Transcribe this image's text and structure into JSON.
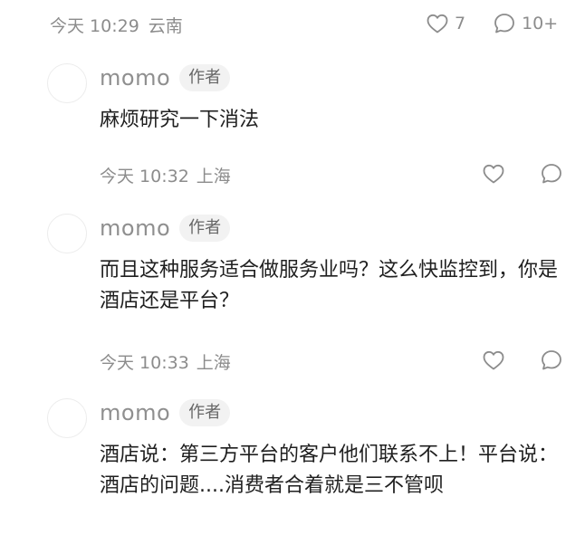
{
  "post": {
    "time": "今天 10:29",
    "location": "云南",
    "like_count": "7",
    "comment_count": "10+"
  },
  "replies": [
    {
      "name": "momo",
      "badge": "作者",
      "text": "麻烦研究一下消法",
      "time": "今天 10:32",
      "location": "上海"
    },
    {
      "name": "momo",
      "badge": "作者",
      "text": "而且这种服务适合做服务业吗？这么快监控到，你是酒店还是平台？",
      "time": "今天 10:33",
      "location": "上海"
    },
    {
      "name": "momo",
      "badge": "作者",
      "text": "酒店说：第三方平台的客户他们联系不上！平台说：酒店的问题....消费者合着就是三不管呗"
    }
  ],
  "icons": {
    "like": "heart-icon",
    "comment": "comment-bubble-icon"
  },
  "colors": {
    "meta_text": "#8c8c8c",
    "body_text": "#1f1f1f",
    "badge_bg": "#f2f2f2"
  }
}
